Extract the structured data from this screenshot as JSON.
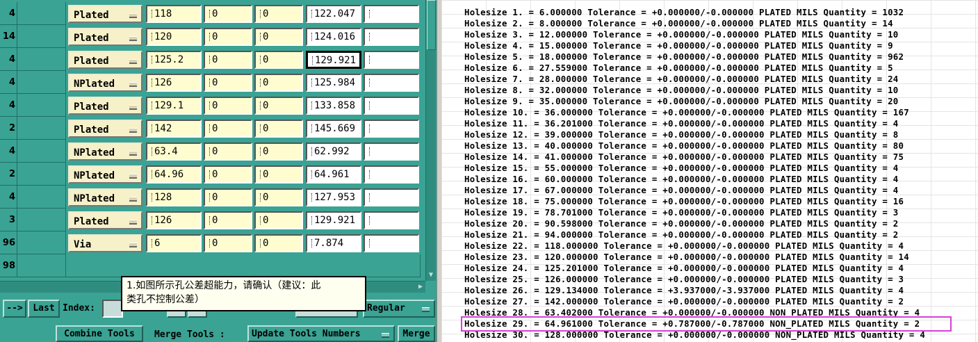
{
  "tool_table": {
    "rows": [
      {
        "count": "4",
        "type": "Plated",
        "size": "118",
        "tol_plus": "0",
        "tol_minus": "0",
        "finish": "122.047",
        "extra": ""
      },
      {
        "count": "14",
        "type": "Plated",
        "size": "120",
        "tol_plus": "0",
        "tol_minus": "0",
        "finish": "124.016",
        "extra": ""
      },
      {
        "count": "4",
        "type": "Plated",
        "size": "125.2",
        "tol_plus": "0",
        "tol_minus": "0",
        "finish": "129.921",
        "extra": ""
      },
      {
        "count": "4",
        "type": "NPlated",
        "size": "126",
        "tol_plus": "0",
        "tol_minus": "0",
        "finish": "125.984",
        "extra": ""
      },
      {
        "count": "4",
        "type": "Plated",
        "size": "129.1",
        "tol_plus": "0",
        "tol_minus": "0",
        "finish": "133.858",
        "extra": ""
      },
      {
        "count": "2",
        "type": "Plated",
        "size": "142",
        "tol_plus": "0",
        "tol_minus": "0",
        "finish": "145.669",
        "extra": ""
      },
      {
        "count": "4",
        "type": "NPlated",
        "size": "63.4",
        "tol_plus": "0",
        "tol_minus": "0",
        "finish": "62.992",
        "extra": ""
      },
      {
        "count": "2",
        "type": "NPlated",
        "size": "64.96",
        "tol_plus": "0",
        "tol_minus": "0",
        "finish": "64.961",
        "extra": ""
      },
      {
        "count": "4",
        "type": "NPlated",
        "size": "128",
        "tol_plus": "0",
        "tol_minus": "0",
        "finish": "127.953",
        "extra": ""
      },
      {
        "count": "3",
        "type": "Plated",
        "size": "126",
        "tol_plus": "0",
        "tol_minus": "0",
        "finish": "129.921",
        "extra": ""
      },
      {
        "count": "96",
        "type": "Via",
        "size": "6",
        "tol_plus": "0",
        "tol_minus": "0",
        "finish": "7.874",
        "extra": ""
      }
    ],
    "last_row_count": "98"
  },
  "controls": {
    "next_button": "-->",
    "last_button": "Last",
    "index_label": "Index:",
    "regular_dropdown": "Regular",
    "combine_tools": "Combine Tools",
    "merge_tools_label": "Merge Tools :",
    "update_tools_dropdown": "Update Tools Numbers",
    "merge_button": "Merge"
  },
  "annotation": {
    "line1": "1.如图所示孔公差超能力，请确认（建议：此",
    "line2": "类孔不控制公差）"
  },
  "hole_list": [
    "Holesize 1. = 6.000000 Tolerance = +0.000000/-0.000000 PLATED MILS Quantity = 1032",
    "Holesize 2. = 8.000000 Tolerance = +0.000000/-0.000000 PLATED MILS Quantity = 14",
    "Holesize 3. = 12.000000 Tolerance = +0.000000/-0.000000 PLATED MILS Quantity = 10",
    "Holesize 4. = 15.000000 Tolerance = +0.000000/-0.000000 PLATED MILS Quantity = 9",
    "Holesize 5. = 18.000000 Tolerance = +0.000000/-0.000000 PLATED MILS Quantity = 962",
    "Holesize 6. = 27.559000 Tolerance = +0.000000/-0.000000 PLATED MILS Quantity = 5",
    "Holesize 7. = 28.000000 Tolerance = +0.000000/-0.000000 PLATED MILS Quantity = 24",
    "Holesize 8. = 32.000000 Tolerance = +0.000000/-0.000000 PLATED MILS Quantity = 10",
    "Holesize 9. = 35.000000 Tolerance = +0.000000/-0.000000 PLATED MILS Quantity = 20",
    "Holesize 10. = 36.000000 Tolerance = +0.000000/-0.000000 PLATED MILS Quantity = 167",
    "Holesize 11. = 36.201000 Tolerance = +0.000000/-0.000000 PLATED MILS Quantity = 4",
    "Holesize 12. = 39.000000 Tolerance = +0.000000/-0.000000 PLATED MILS Quantity = 8",
    "Holesize 13. = 40.000000 Tolerance = +0.000000/-0.000000 PLATED MILS Quantity = 80",
    "Holesize 14. = 41.000000 Tolerance = +0.000000/-0.000000 PLATED MILS Quantity = 75",
    "Holesize 15. = 55.000000 Tolerance = +0.000000/-0.000000 PLATED MILS Quantity = 4",
    "Holesize 16. = 60.000000 Tolerance = +0.000000/-0.000000 PLATED MILS Quantity = 4",
    "Holesize 17. = 67.000000 Tolerance = +0.000000/-0.000000 PLATED MILS Quantity = 4",
    "Holesize 18. = 75.000000 Tolerance = +0.000000/-0.000000 PLATED MILS Quantity = 16",
    "Holesize 19. = 78.701000 Tolerance = +0.000000/-0.000000 PLATED MILS Quantity = 3",
    "Holesize 20. = 90.598000 Tolerance = +0.000000/-0.000000 PLATED MILS Quantity = 2",
    "Holesize 21. = 94.000000 Tolerance = +0.000000/-0.000000 PLATED MILS Quantity = 2",
    "Holesize 22. = 118.000000 Tolerance = +0.000000/-0.000000 PLATED MILS Quantity = 4",
    "Holesize 23. = 120.000000 Tolerance = +0.000000/-0.000000 PLATED MILS Quantity = 14",
    "Holesize 24. = 125.201000 Tolerance = +0.000000/-0.000000 PLATED MILS Quantity = 4",
    "Holesize 25. = 126.000000 Tolerance = +0.000000/-0.000000 PLATED MILS Quantity = 3",
    "Holesize 26. = 129.134000 Tolerance = +3.937000/-3.937000 PLATED MILS Quantity = 4",
    "Holesize 27. = 142.000000 Tolerance = +0.000000/-0.000000 PLATED MILS Quantity = 2",
    "Holesize 28. = 63.402000 Tolerance = +0.000000/-0.000000 NON_PLATED MILS Quantity = 4",
    "Holesize 29. = 64.961000 Tolerance = +0.787000/-0.787000 NON_PLATED MILS Quantity = 2",
    "Holesize 30. = 128.000000 Tolerance = +0.000000/-0.000000 NON_PLATED MILS Quantity = 4"
  ],
  "highlighted_index": 28,
  "colors": {
    "panel": "#3aa394",
    "field": "#fffdd0",
    "highlight": "#d640d6"
  }
}
